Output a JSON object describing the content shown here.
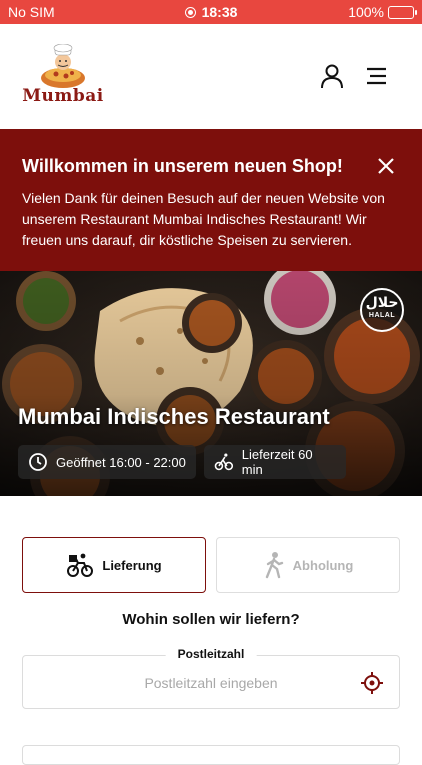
{
  "status_bar": {
    "carrier": "No SIM",
    "time": "18:38",
    "battery": "100%"
  },
  "header": {
    "logo_text": "Mumbai"
  },
  "banner": {
    "title": "Willkommen in unserem neuen Shop!",
    "body": "Vielen Dank für deinen Besuch auf der neuen Website von unserem Restaurant Mumbai Indisches Restaurant! Wir freuen uns darauf, dir köstliche Speisen zu servieren."
  },
  "hero": {
    "restaurant_name": "Mumbai Indisches Restaurant",
    "opening_hours": "Geöffnet 16:00 - 22:00",
    "delivery_time": "Lieferzeit 60 min",
    "halal_ar": "حلال",
    "halal_en": "HALAL"
  },
  "order_mode": {
    "delivery_label": "Lieferung",
    "pickup_label": "Abholung",
    "selected": "delivery"
  },
  "address": {
    "question": "Wohin sollen wir liefern?",
    "zip_label": "Postleitzahl",
    "zip_placeholder": "Postleitzahl eingeben",
    "zip_value": ""
  },
  "colors": {
    "status_bar": "#e8473f",
    "brand": "#7d0f0c",
    "accent": "#8b1a14"
  },
  "icons": {
    "user": "user-icon",
    "menu": "menu-icon",
    "close": "close-icon",
    "clock": "clock-icon",
    "bike": "bike-icon",
    "walk": "walking-icon",
    "locate": "crosshair-icon"
  }
}
